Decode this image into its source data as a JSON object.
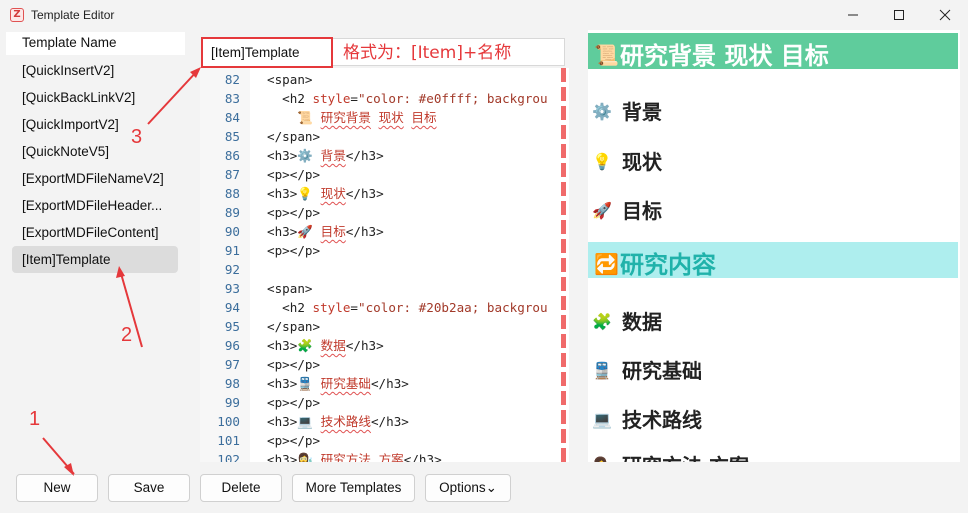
{
  "window": {
    "title": "Template Editor",
    "app_icon_glyph": "Z",
    "controls": [
      "minimize-icon",
      "maximize-icon",
      "close-icon"
    ]
  },
  "template_list": {
    "header": "Template Name",
    "items": [
      {
        "label": "[QuickInsertV2]"
      },
      {
        "label": "[QuickBackLinkV2]"
      },
      {
        "label": "[QuickImportV2]"
      },
      {
        "label": "[QuickNoteV5]"
      },
      {
        "label": "[ExportMDFileNameV2]"
      },
      {
        "label": "[ExportMDFileHeader..."
      },
      {
        "label": "[ExportMDFileContent]"
      },
      {
        "label": "[Item]Template"
      }
    ],
    "selected_index": 7
  },
  "name_field": {
    "value": "[Item]Template"
  },
  "editor": {
    "lines": [
      {
        "num": "82",
        "text": "<span>"
      },
      {
        "num": "83",
        "text": "  <h2 style=\"color: #e0ffff; backgrou"
      },
      {
        "num": "84",
        "text": "    📜 研究背景 现状 目标"
      },
      {
        "num": "85",
        "text": "</span>"
      },
      {
        "num": "86",
        "text": "<h3>⚙️ 背景</h3>"
      },
      {
        "num": "87",
        "text": "<p></p>"
      },
      {
        "num": "88",
        "text": "<h3>💡 现状</h3>"
      },
      {
        "num": "89",
        "text": "<p></p>"
      },
      {
        "num": "90",
        "text": "<h3>🚀 目标</h3>"
      },
      {
        "num": "91",
        "text": "<p></p>"
      },
      {
        "num": "92",
        "text": ""
      },
      {
        "num": "93",
        "text": "<span>"
      },
      {
        "num": "94",
        "text": "  <h2 style=\"color: #20b2aa; backgrou"
      },
      {
        "num": "95",
        "text": "</span>"
      },
      {
        "num": "96",
        "text": "<h3>🧩 数据</h3>"
      },
      {
        "num": "97",
        "text": "<p></p>"
      },
      {
        "num": "98",
        "text": "<h3>🚆 研究基础</h3>"
      },
      {
        "num": "99",
        "text": "<p></p>"
      },
      {
        "num": "100",
        "text": "<h3>💻 技术路线</h3>"
      },
      {
        "num": "101",
        "text": "<p></p>"
      },
      {
        "num": "102",
        "text": "<h3>👩‍🔬 研究方法 方案</h3>"
      }
    ]
  },
  "preview": {
    "h2_1": {
      "icon": "scroll-icon",
      "glyph": "📜",
      "text": "研究背景 现状 目标",
      "bg": "#5fcc9c",
      "color": "#ffffff"
    },
    "h3_items_1": [
      {
        "icon": "gear-icon",
        "glyph": "⚙️",
        "text": "背景"
      },
      {
        "icon": "lightbulb-icon",
        "glyph": "💡",
        "text": "现状"
      },
      {
        "icon": "rocket-icon",
        "glyph": "🚀",
        "text": "目标"
      }
    ],
    "h2_2": {
      "icon": "repeat-icon",
      "glyph": "🔁",
      "text": "研究内容",
      "bg": "#aeeeee",
      "color": "#20b2aa"
    },
    "h3_items_2": [
      {
        "icon": "puzzle-icon",
        "glyph": "🧩",
        "text": "数据"
      },
      {
        "icon": "train-icon",
        "glyph": "🚆",
        "text": "研究基础"
      },
      {
        "icon": "laptop-icon",
        "glyph": "💻",
        "text": "技术路线"
      },
      {
        "icon": "scientist-icon",
        "glyph": "👩‍🔬",
        "text": "研究方法 方案"
      }
    ]
  },
  "buttons": {
    "new": "New",
    "save": "Save",
    "delete": "Delete",
    "more_templates": "More Templates",
    "options": "Options",
    "options_chevron": "⌄"
  },
  "annotations": {
    "format_note": "格式为：[Item]+名称",
    "num_1": "1",
    "num_2": "2",
    "num_3": "3",
    "color": "#e5383b"
  }
}
